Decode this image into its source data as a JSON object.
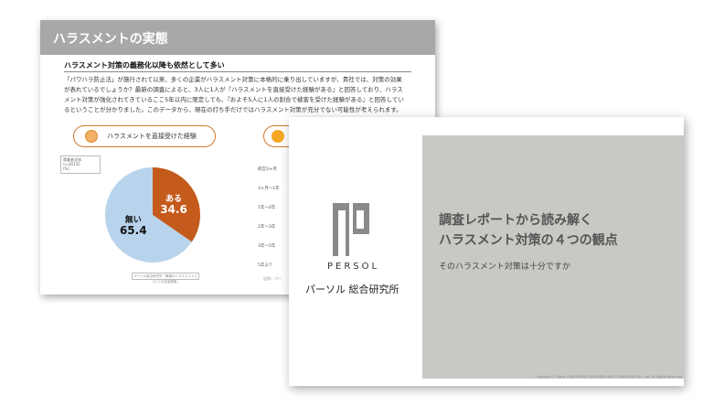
{
  "back_slide": {
    "header_title": "ハラスメントの実態",
    "subtitle": "ハラスメント対策の義務化以降も依然として多い",
    "body_lines": [
      "「パワハラ防止法」が施行されて以来、多くの企業がハラスメント対策に本格的に乗り出していますが、貴社では、対策の効果",
      "が表れているでしょうか？最新の調査によると、3人に1人が『ハラスメントを直接受けた経験がある』と回答しており、ハラス",
      "メント対策が強化されてきているここ5年以内に限定しても、『およそ5人に1人の割合で被害を受けた経験がある』と回答してい",
      "るということが分かりました。このデータから、現在の打ち手だけではハラスメント対策が充分でない可能性が考えられます。"
    ],
    "pill_label": "ハラスメントを直接受けた経験",
    "legend_box": [
      "就業者全体",
      "n=28135",
      "(%)"
    ],
    "source_note": "パーソル総合研究所「職場のハラスメントについての定量調査」",
    "right_rows": [
      "経営3ヶ月",
      "3ヶ月〜1年",
      "1年〜2年",
      "2年〜3年",
      "3年〜5年",
      "5年より"
    ],
    "bottom_note": "出所：パー"
  },
  "chart_data": {
    "type": "pie",
    "categories": [
      "ある",
      "無い"
    ],
    "values": [
      34.6,
      65.4
    ],
    "colors": [
      "#c45a1c",
      "#b8d4ec"
    ]
  },
  "front_slide": {
    "brand": "PERSOL",
    "company": "パーソル 総合研究所",
    "title_line1": "調査レポートから読み解く",
    "title_line2": "ハラスメント対策の４つの観点",
    "subtitle": "そのハラスメント対策は十分ですか",
    "copyright": "Copyright © Since 2016 PERSOL RESEARCH AND CONSULTING Co., Ltd. All Rights Reserved."
  }
}
